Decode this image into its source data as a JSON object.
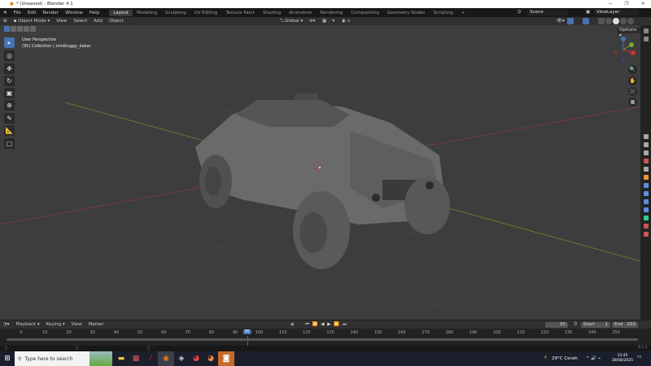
{
  "window": {
    "title": "* (Unsaved) - Blender 4.1",
    "minimize": "—",
    "maximize": "❐",
    "close": "✕"
  },
  "menu": [
    "File",
    "Edit",
    "Render",
    "Window",
    "Help"
  ],
  "workspaces": [
    "Layout",
    "Modeling",
    "Sculpting",
    "UV Editing",
    "Texture Paint",
    "Shading",
    "Animation",
    "Rendering",
    "Compositing",
    "Geometry Nodes",
    "Scripting",
    "+"
  ],
  "scene": "Scene",
  "view_layer": "ViewLayer",
  "header": {
    "mode": "Object Mode",
    "items": [
      "View",
      "Select",
      "Add",
      "Object"
    ],
    "orientation": "Global",
    "options": "Options"
  },
  "viewport": {
    "perspective": "User Perspective",
    "collection": "(95) Collection | minibuggy_dakar"
  },
  "gizmo": {
    "x": "X",
    "y": "Y",
    "z": "Z"
  },
  "timeline": {
    "menus": [
      "Playback",
      "Keying",
      "View",
      "Marker"
    ],
    "current_frame": "95",
    "start_label": "Start",
    "start": "1",
    "end_label": "End",
    "end": "250",
    "ticks": [
      0,
      10,
      20,
      30,
      40,
      50,
      60,
      70,
      80,
      90,
      100,
      110,
      120,
      130,
      140,
      150,
      160,
      170,
      180,
      190,
      200,
      210,
      220,
      230,
      240,
      250
    ]
  },
  "status": {
    "version": "4.1.1"
  },
  "taskbar": {
    "search_placeholder": "Type here to search",
    "weather": "29°C  Cerah",
    "time": "15:45",
    "date": "28/08/2025"
  },
  "colors": {
    "accent": "#4772b3",
    "viewport": "#3d3d3d",
    "frame": "#4772b3"
  }
}
